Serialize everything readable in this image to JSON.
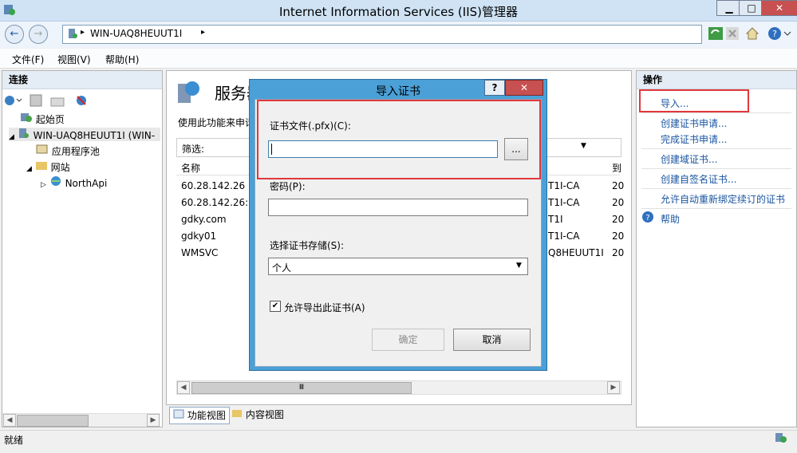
{
  "window": {
    "title": "Internet Information Services (IIS)管理器",
    "controls": {
      "minimize": "▁",
      "maximize": "□",
      "close": "✕"
    }
  },
  "address": {
    "path": "WIN-UAQ8HEUUT1I",
    "separator_left": "▸",
    "separator_right": "▸"
  },
  "menu": {
    "file": "文件(F)",
    "view": "视图(V)",
    "help": "帮助(H)"
  },
  "connections": {
    "header": "连接",
    "tree": [
      {
        "label": "起始页"
      },
      {
        "label": "WIN-UAQ8HEUUT1I (WIN-"
      },
      {
        "label": "应用程序池"
      },
      {
        "label": "网站"
      },
      {
        "label": "NorthApi"
      }
    ]
  },
  "center": {
    "heading": "服务器",
    "description": "使用此功能来申请",
    "filter_label": "筛选:",
    "column_name": "名称",
    "column_issued_to": "到",
    "rows": [
      {
        "name": "60.28.142.26",
        "issuer": "T1I-CA",
        "date": "20"
      },
      {
        "name": "60.28.142.26:9",
        "issuer": "T1I-CA",
        "date": "20"
      },
      {
        "name": "gdky.com",
        "issuer": "T1I",
        "date": "20"
      },
      {
        "name": "gdky01",
        "issuer": "T1I-CA",
        "date": "20"
      },
      {
        "name": "WMSVC",
        "issuer": "Q8HEUUT1I",
        "date": "20"
      }
    ],
    "scroll_thumb": "Ⅲ"
  },
  "view_tabs": {
    "features": "功能视图",
    "content": "内容视图"
  },
  "actions": {
    "header": "操作",
    "items": [
      "导入...",
      "创建证书申请...",
      "完成证书申请...",
      "创建域证书...",
      "创建自签名证书...",
      "允许自动重新绑定续订的证书"
    ],
    "help": "帮助"
  },
  "dialog": {
    "title": "导入证书",
    "help_button": "?",
    "close_button": "✕",
    "cert_file_label": "证书文件(.pfx)(C):",
    "cert_file_value": "",
    "browse_label": "...",
    "password_label": "密码(P):",
    "password_value": "",
    "store_label": "选择证书存储(S):",
    "store_value": "个人",
    "allow_export_label": "允许导出此证书(A)",
    "allow_export_checked": true,
    "ok_label": "确定",
    "cancel_label": "取消"
  },
  "status": {
    "text": "就绪"
  },
  "colors": {
    "highlight": "#e0383d",
    "link": "#1a55a0",
    "dialog_frame": "#4aa0d7"
  }
}
